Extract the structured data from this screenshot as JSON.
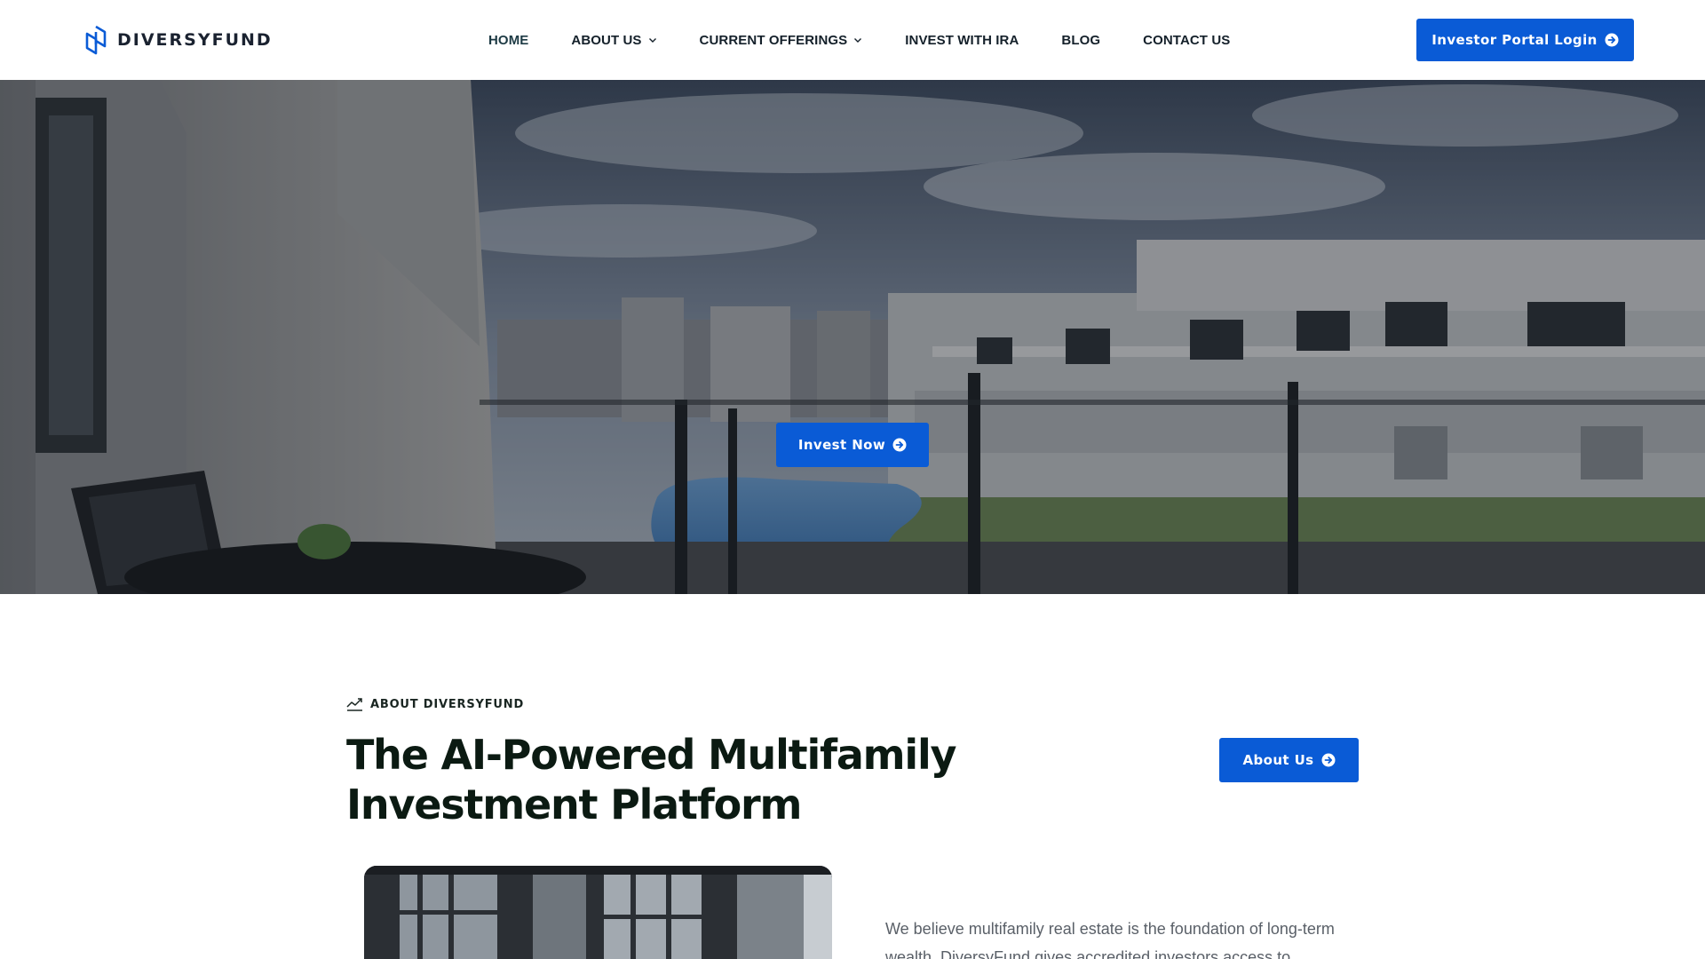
{
  "header": {
    "logo_text": "DIVERSYFUND",
    "nav": [
      {
        "label": "HOME"
      },
      {
        "label": "ABOUT US"
      },
      {
        "label": "CURRENT OFFERINGS"
      },
      {
        "label": "INVEST WITH IRA"
      },
      {
        "label": "BLOG"
      },
      {
        "label": "CONTACT US"
      }
    ],
    "portal_button": "Investor Portal Login"
  },
  "hero": {
    "cta_label": "Invest Now"
  },
  "about": {
    "eyebrow": "ABOUT DIVERSYFUND",
    "title": "The AI-Powered Multifamily Investment Platform",
    "button": "About Us",
    "body": "We believe multifamily real estate is the foundation of long-term wealth. DiversyFund gives accredited investors access to"
  },
  "colors": {
    "accent": "#0a5bd6",
    "heading": "#0b1a12",
    "nav_text": "#14202a",
    "body_text": "#5a6068"
  },
  "icons": {
    "logo_mark": "diversyfund-logo-icon",
    "chevron": "chevron-down-icon",
    "arrow_circle": "arrow-right-circle-icon",
    "trend": "trend-up-icon"
  }
}
